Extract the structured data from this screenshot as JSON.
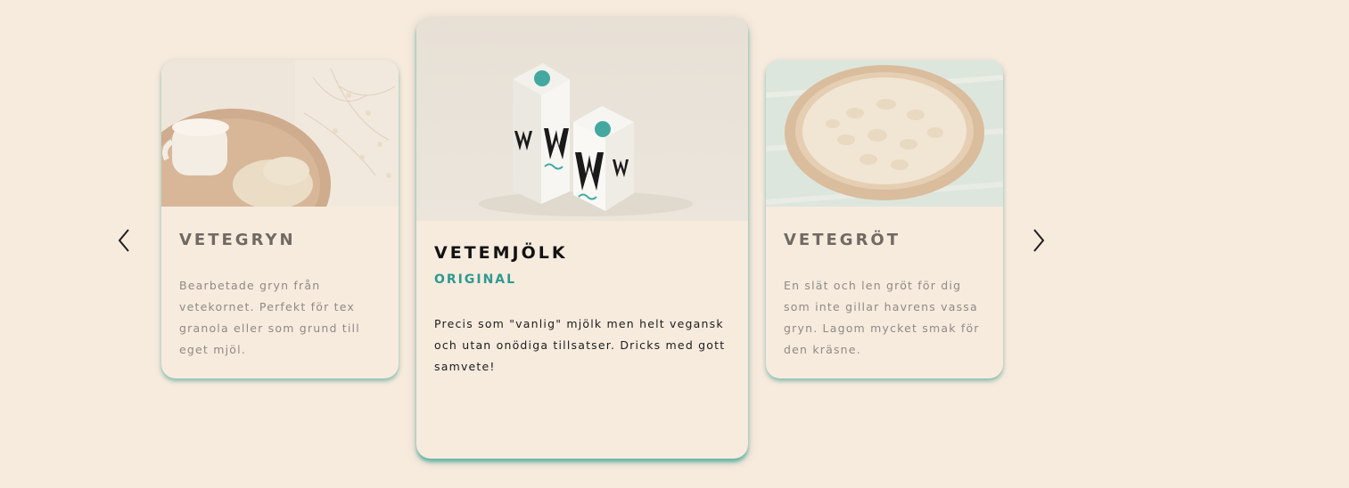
{
  "carousel": {
    "prev_icon": "chevron-left-icon",
    "next_icon": "chevron-right-icon",
    "cards": [
      {
        "title": "VETEGRYN",
        "description": "Bearbetade gryn från vetekornet. Perfekt för tex granola eller som grund till eget mjöl.",
        "image": "milk-and-oats-photo"
      },
      {
        "title": "VETEMJÖLK",
        "subtitle": "ORIGINAL",
        "description": "Precis som \"vanlig\" mjölk men helt vegansk och utan onödiga tillsatser. Dricks med gott samvete!",
        "image": "milk-cartons-photo"
      },
      {
        "title": "VETEGRÖT",
        "description": "En slät och len gröt för dig som inte gillar havrens vassa gryn. Lagom mycket smak för den kräsne.",
        "image": "oat-bowl-photo"
      }
    ]
  },
  "colors": {
    "background": "#f7ebde",
    "accent": "#2c9a91",
    "shadow_accent": "#3aa898",
    "featured_title": "#121212",
    "muted_title": "#6f6a63",
    "muted_text": "#8f8a84"
  }
}
